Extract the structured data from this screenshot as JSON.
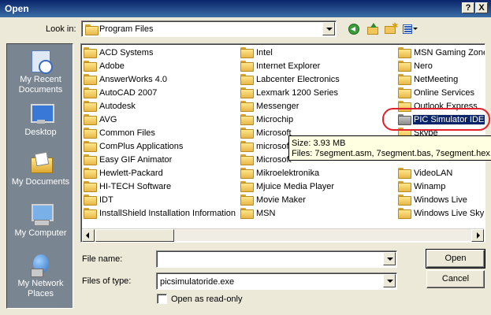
{
  "window": {
    "title": "Open",
    "help_label": "?",
    "close_label": "X"
  },
  "lookin": {
    "label": "Look in:",
    "value": "Program Files"
  },
  "toolbar": {
    "icons": [
      "back-icon",
      "up-folder-icon",
      "new-folder-icon",
      "views-menu-icon"
    ]
  },
  "places": [
    {
      "label": "My Recent Documents",
      "icon": "recent-documents-icon"
    },
    {
      "label": "Desktop",
      "icon": "desktop-icon"
    },
    {
      "label": "My Documents",
      "icon": "my-documents-icon"
    },
    {
      "label": "My Computer",
      "icon": "my-computer-icon"
    },
    {
      "label": "My Network Places",
      "icon": "network-places-icon"
    }
  ],
  "files": {
    "col1": [
      "ACD Systems",
      "Adobe",
      "AnswerWorks 4.0",
      "AutoCAD 2007",
      "Autodesk",
      "AVG",
      "Common Files",
      "ComPlus Applications",
      "Easy GIF Animator",
      "Hewlett-Packard",
      "HI-TECH Software",
      "IDT",
      "InstallShield Installation Information"
    ],
    "col2": [
      "Intel",
      "Internet Explorer",
      "Labcenter Electronics",
      "Lexmark 1200 Series",
      "Messenger",
      "Microchip",
      "Microsoft",
      "microsoft",
      "Microsoft",
      "Mikroelektronika",
      "Mjuice Media Player",
      "Movie Maker",
      "MSN"
    ],
    "col3": [
      "MSN Gaming Zone",
      "Nero",
      "NetMeeting",
      "Online Services",
      "Outlook Express",
      "PIC Simulator IDE",
      "Skype",
      "",
      "",
      "VideoLAN",
      "Winamp",
      "Windows Live",
      "Windows Live SkyD"
    ],
    "selected": "PIC Simulator IDE"
  },
  "tooltip": {
    "line1": "Size: 3.93 MB",
    "line2": "Files: 7segment.asm, 7segment.bas, 7segment.hex, ..."
  },
  "form": {
    "filename_label": "File name:",
    "filename_value": "",
    "filetype_label": "Files of type:",
    "filetype_value": "picsimulatoride.exe",
    "readonly_label": "Open as read-only",
    "open_label": "Open",
    "cancel_label": "Cancel"
  },
  "colors": {
    "titlebar": "#0a246a",
    "places_bg": "#7a8592",
    "highlight_ring": "#e0202a",
    "tooltip_bg": "#ffffe1"
  }
}
